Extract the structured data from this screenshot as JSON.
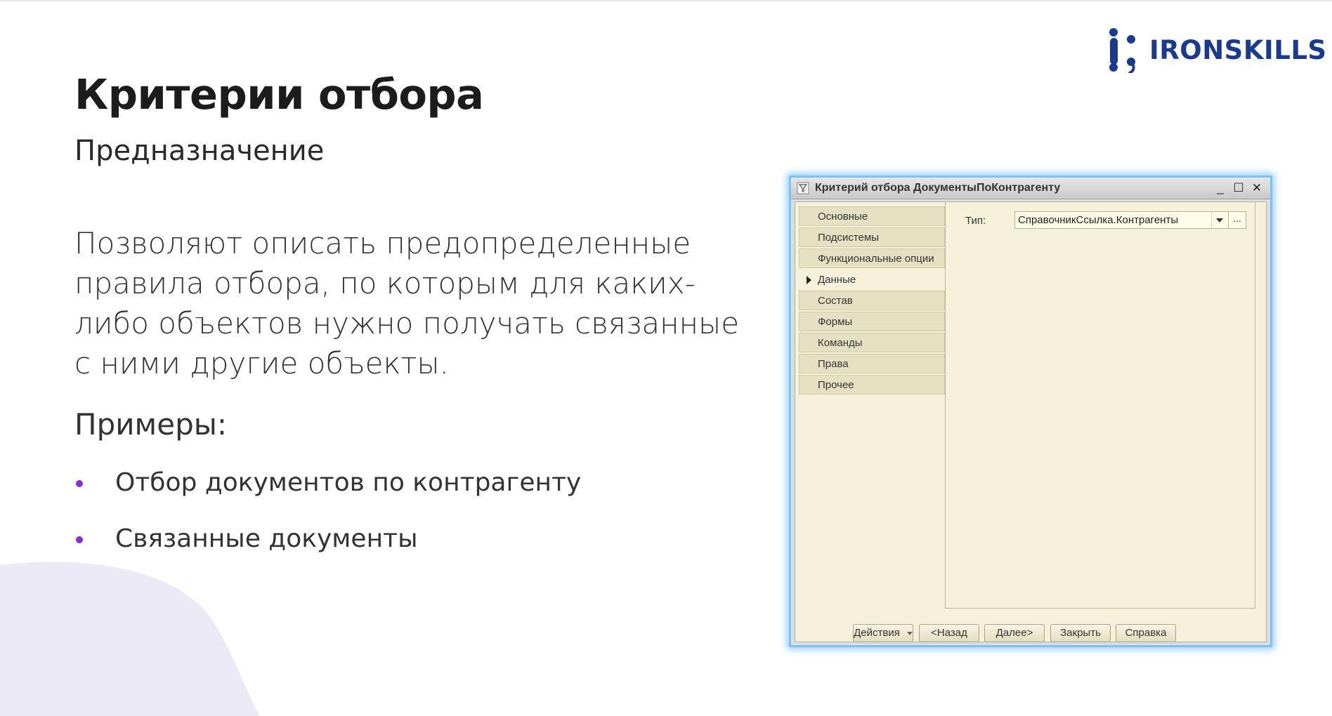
{
  "logo": {
    "text": "IRONSKILLS",
    "color": "#1a3a8e"
  },
  "title": "Критерии отбора",
  "subtitle": "Предназначение",
  "body": "Позволяют описать предопределенные правила отбора, по которым для каких-либо объектов нужно получать связанные с ними другие объекты.",
  "examples_label": "Примеры:",
  "bullets": [
    {
      "text": "Отбор документов по контрагенту"
    },
    {
      "text": "Связанные документы"
    }
  ],
  "accent_color": "#8a2bd3",
  "window": {
    "title": "Критерий отбора ДокументыПоКонтрагенту",
    "controls": {
      "minimize": "_",
      "maximize": "☐",
      "close": "✕"
    },
    "nav": [
      {
        "label": "Основные",
        "active": false
      },
      {
        "label": "Подсистемы",
        "active": false
      },
      {
        "label": "Функциональные опции",
        "active": false
      },
      {
        "label": "Данные",
        "active": true
      },
      {
        "label": "Состав",
        "active": false
      },
      {
        "label": "Формы",
        "active": false
      },
      {
        "label": "Команды",
        "active": false
      },
      {
        "label": "Права",
        "active": false
      },
      {
        "label": "Прочее",
        "active": false
      }
    ],
    "type_field": {
      "label": "Тип:",
      "value": "СправочникСсылка.Контрагенты",
      "more": "..."
    },
    "buttons": {
      "actions": "Действия",
      "back": "<Назад",
      "next": "Далее>",
      "close": "Закрыть",
      "help": "Справка"
    }
  }
}
